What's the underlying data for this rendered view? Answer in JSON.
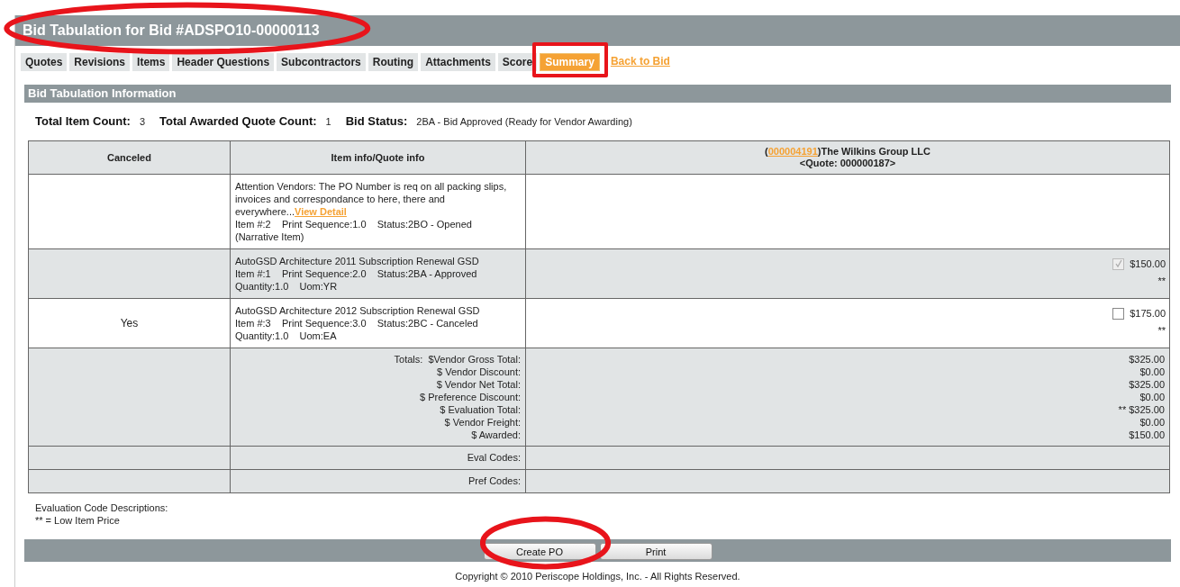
{
  "title": {
    "text": "Bid Tabulation for Bid #ADSPO10-00000113",
    "highlighted": true
  },
  "tabs": [
    {
      "label": "Quotes",
      "selected": false,
      "highlighted": false
    },
    {
      "label": "Revisions",
      "selected": false,
      "highlighted": false
    },
    {
      "label": "Items",
      "selected": false,
      "highlighted": false
    },
    {
      "label": "Header Questions",
      "selected": false,
      "highlighted": false
    },
    {
      "label": "Subcontractors",
      "selected": false,
      "highlighted": false
    },
    {
      "label": "Routing",
      "selected": false,
      "highlighted": false
    },
    {
      "label": "Attachments",
      "selected": false,
      "highlighted": false
    },
    {
      "label": "Score",
      "selected": false,
      "highlighted": false
    },
    {
      "label": "Summary",
      "selected": true,
      "highlighted": true
    }
  ],
  "back_link": "Back to Bid",
  "section_title": "Bid Tabulation Information",
  "summary": [
    {
      "label": "Total Item Count:",
      "value": "3"
    },
    {
      "label": "Total Awarded Quote Count:",
      "value": "1"
    },
    {
      "label": "Bid Status:",
      "value": "2BA - Bid Approved (Ready for Vendor Awarding)"
    }
  ],
  "table": {
    "columns": [
      "Canceled",
      "Item info/Quote info"
    ],
    "vendor": {
      "id_open": "(",
      "id": "000004191",
      "id_close": ")",
      "name": "The Wilkins Group LLC",
      "quote": "<Quote: 000000187>"
    },
    "rows": [
      {
        "canceled": "",
        "description": "Attention Vendors: The PO Number is req on all packing slips, invoices and correspondance to here, there and everywhere...",
        "link": "View Detail",
        "details": [
          "Item #:2    Print Sequence:1.0    Status:2BO - Opened",
          "(Narrative Item)"
        ]
      },
      {
        "canceled": "",
        "description": "AutoGSD Architecture 2011 Subscription Renewal GSD",
        "details": [
          "Item #:1    Print Sequence:2.0    Status:2BA - Approved",
          "Quantity:1.0    Uom:YR"
        ],
        "quote": {
          "checked": true,
          "disabled": true,
          "price": "$150.00",
          "eval": "**"
        }
      },
      {
        "canceled": "Yes",
        "description": "AutoGSD Architecture 2012 Subscription Renewal GSD",
        "details": [
          "Item #:3    Print Sequence:3.0    Status:2BC - Canceled",
          "Quantity:1.0    Uom:EA"
        ],
        "quote": {
          "checked": false,
          "disabled": false,
          "price": "$175.00",
          "eval": "**"
        }
      }
    ],
    "totals": [
      {
        "label": "Totals:  $Vendor Gross Total:",
        "value": "$325.00"
      },
      {
        "label": "$ Vendor Discount:",
        "value": "$0.00"
      },
      {
        "label": "$ Vendor Net Total:",
        "value": "$325.00"
      },
      {
        "label": "$ Preference Discount:",
        "value": "$0.00"
      },
      {
        "label": "$ Evaluation Total:",
        "value": "** $325.00"
      },
      {
        "label": "$ Vendor Freight:",
        "value": "$0.00"
      },
      {
        "label": "$ Awarded:",
        "value": "$150.00"
      }
    ],
    "code_rows": [
      "Eval Codes:",
      "Pref Codes:"
    ]
  },
  "notes": [
    "Evaluation Code Descriptions:",
    "** = Low Item Price"
  ],
  "buttons": [
    {
      "label": "Create PO",
      "highlighted": true
    },
    {
      "label": "Print",
      "highlighted": false
    }
  ],
  "copyright": "Copyright © 2010 Periscope Holdings, Inc. - All Rights Reserved."
}
